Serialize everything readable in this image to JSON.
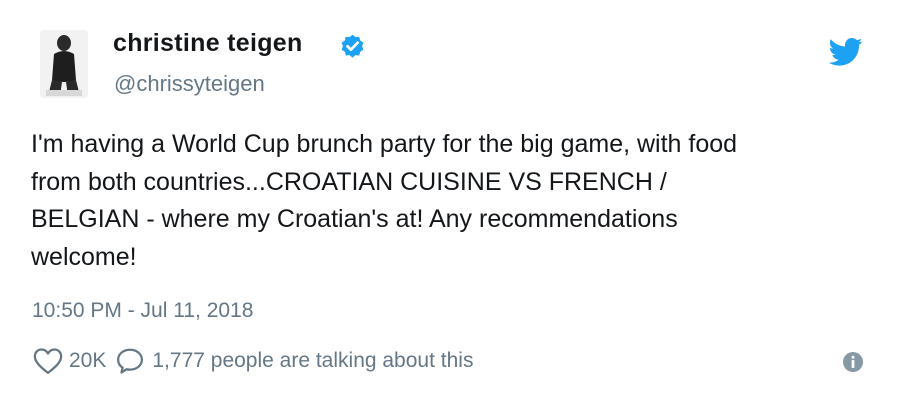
{
  "user": {
    "name": "christine teigen",
    "handle": "@chrissyteigen",
    "verified": true
  },
  "tweet": {
    "lines": [
      "I'm having a World Cup brunch party for the big game, with food",
      "from both countries...CROATIAN CUISINE VS FRENCH /",
      "BELGIAN - where my Croatian's at! Any recommendations",
      "welcome!"
    ],
    "timestamp": "10:50 PM - Jul 11, 2018"
  },
  "actions": {
    "likes": "20K",
    "talking": "1,777 people are talking about this"
  },
  "icons": {
    "bird": "twitter-bird-icon",
    "verified": "verified-badge-icon",
    "like": "heart-icon",
    "reply": "speech-bubble-icon",
    "info": "info-icon"
  },
  "colors": {
    "brand": "#1da1f2",
    "text": "#14171a",
    "secondary": "#657786"
  }
}
